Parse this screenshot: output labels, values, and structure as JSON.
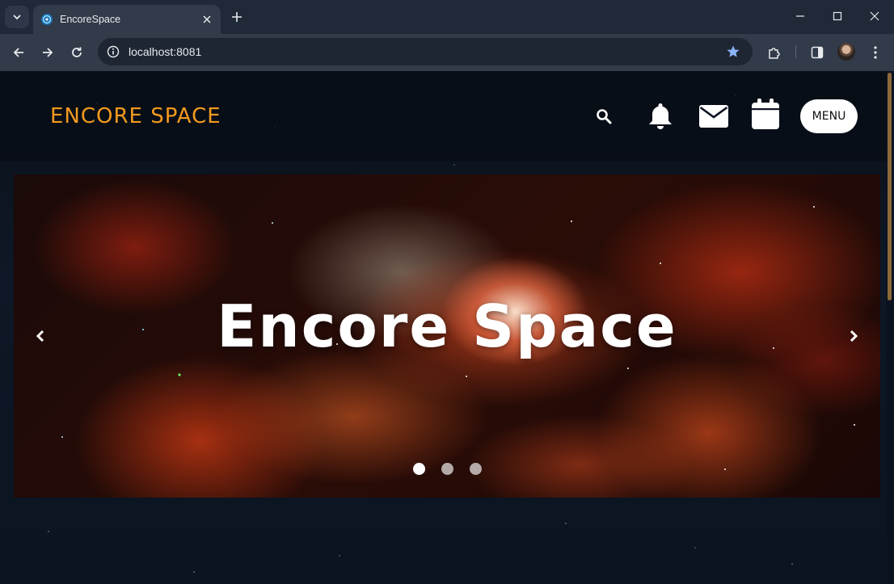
{
  "browser": {
    "tab_title": "EncoreSpace",
    "url": "localhost:8081"
  },
  "site": {
    "brand": "ENCORE SPACE",
    "menu_label": "MENU",
    "header_icons": [
      "search-icon",
      "bell-icon",
      "mail-icon",
      "calendar-icon"
    ]
  },
  "hero": {
    "title": "Encore Space",
    "slide_count": 3,
    "active_slide": 1
  },
  "colors": {
    "brand": "#f29a1f",
    "chrome_dark": "#1f2937",
    "chrome_toolbar": "#323b4a",
    "star_active": "#8ab4f8"
  }
}
